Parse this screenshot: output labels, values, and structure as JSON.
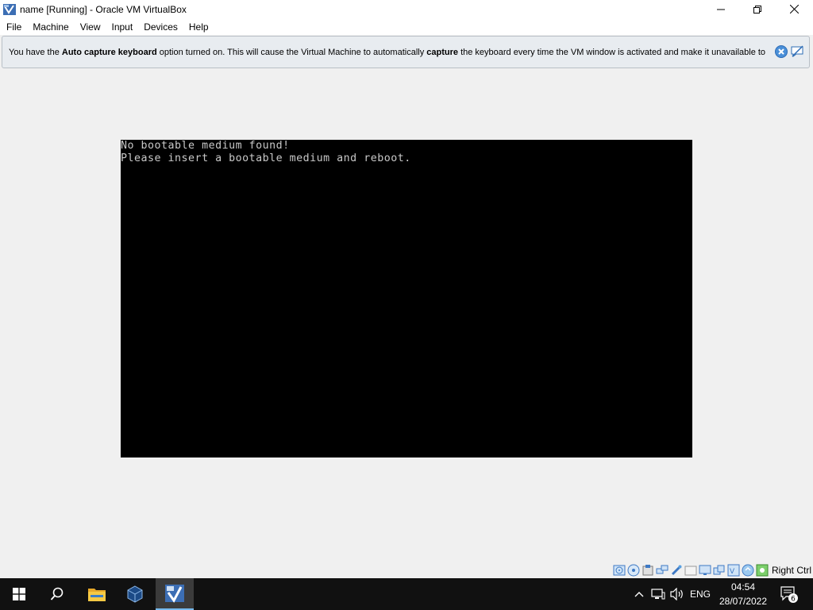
{
  "window": {
    "title": "name [Running] - Oracle VM VirtualBox"
  },
  "menu": [
    "File",
    "Machine",
    "View",
    "Input",
    "Devices",
    "Help"
  ],
  "notice": {
    "parts": [
      {
        "text": "You have the ",
        "bold": false
      },
      {
        "text": "Auto capture keyboard",
        "bold": true
      },
      {
        "text": " option turned on. This will cause the Virtual Machine to automatically ",
        "bold": false
      },
      {
        "text": "capture",
        "bold": true
      },
      {
        "text": " the keyboard every time the VM window is activated and make it unavailable to",
        "bold": false
      }
    ]
  },
  "vm_screen": {
    "lines": [
      "No bootable medium found!",
      "Please insert a bootable medium and reboot."
    ]
  },
  "statusbar": {
    "icons": [
      "hard-disk-icon",
      "optical-drive-icon",
      "audio-icon",
      "network-icon",
      "usb-icon",
      "shared-folders-icon",
      "display-icon",
      "recording-icon",
      "cpu-icon",
      "mouse-integration-icon",
      "keyboard-icon"
    ],
    "host_key": "Right Ctrl"
  },
  "taskbar": {
    "language": "ENG",
    "time": "04:54",
    "date": "28/07/2022",
    "notification_count": "6",
    "colors": {
      "background": "#111111",
      "active_indicator": "#76b9ed"
    }
  }
}
